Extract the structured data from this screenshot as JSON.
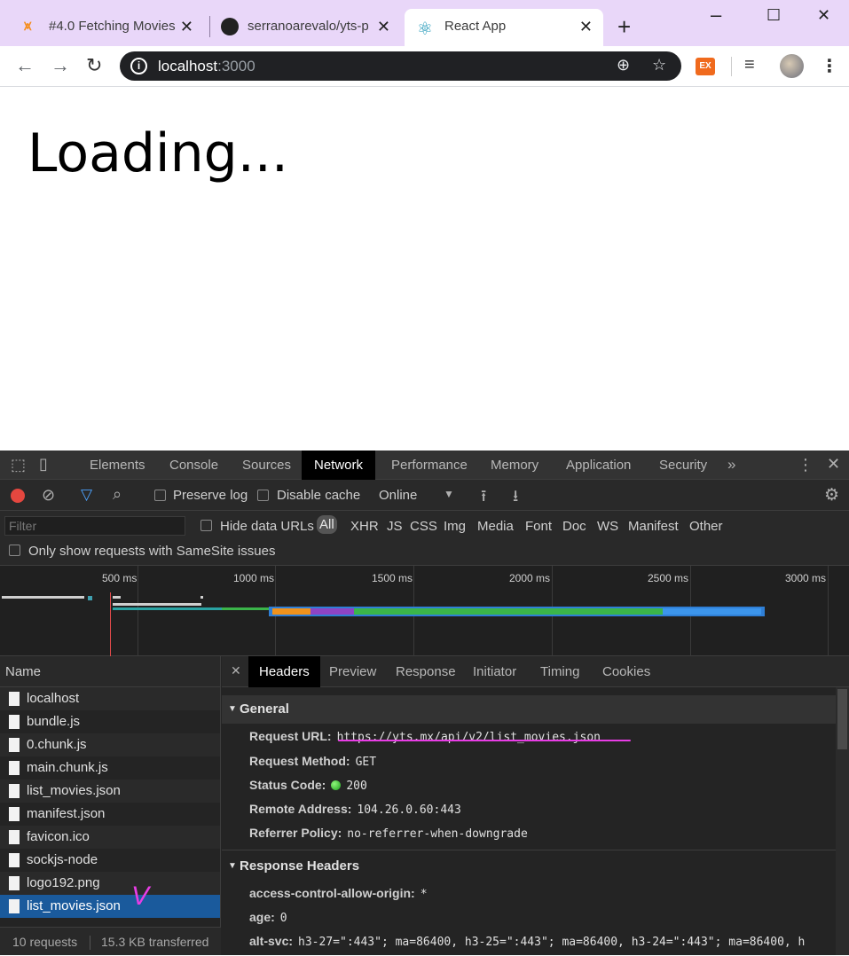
{
  "browser": {
    "tabs": [
      {
        "title": "#4.0 Fetching Movies",
        "icon": "m-logo-icon"
      },
      {
        "title": "serranoarevalo/yts-p",
        "icon": "github-icon"
      },
      {
        "title": "React App",
        "icon": "react-icon"
      }
    ],
    "url_host": "localhost",
    "url_port": ":3000",
    "ext_label": "EX"
  },
  "page": {
    "heading": "Loading..."
  },
  "devtools": {
    "panels": [
      "Elements",
      "Console",
      "Sources",
      "Network",
      "Performance",
      "Memory",
      "Application",
      "Security"
    ],
    "active_panel": "Network",
    "toolbar": {
      "preserve_log": "Preserve log",
      "disable_cache": "Disable cache",
      "throttle": "Online"
    },
    "filter": {
      "placeholder": "Filter",
      "hide_data_urls": "Hide data URLs",
      "types": [
        "All",
        "XHR",
        "JS",
        "CSS",
        "Img",
        "Media",
        "Font",
        "Doc",
        "WS",
        "Manifest",
        "Other"
      ],
      "samesite": "Only show requests with SameSite issues"
    },
    "timeline_labels": [
      "500 ms",
      "1000 ms",
      "1500 ms",
      "2000 ms",
      "2500 ms",
      "3000 ms"
    ],
    "requests_header": "Name",
    "requests": [
      "localhost",
      "bundle.js",
      "0.chunk.js",
      "main.chunk.js",
      "list_movies.json",
      "manifest.json",
      "favicon.ico",
      "sockjs-node",
      "logo192.png",
      "list_movies.json"
    ],
    "summary": {
      "requests": "10 requests",
      "transferred": "15.3 KB transferred"
    },
    "detail_tabs": [
      "Headers",
      "Preview",
      "Response",
      "Initiator",
      "Timing",
      "Cookies"
    ],
    "general": {
      "title": "General",
      "rows": [
        {
          "key": "Request URL:",
          "value": "https://yts.mx/api/v2/list_movies.json"
        },
        {
          "key": "Request Method:",
          "value": "GET"
        },
        {
          "key": "Status Code:",
          "value": "200"
        },
        {
          "key": "Remote Address:",
          "value": "104.26.0.60:443"
        },
        {
          "key": "Referrer Policy:",
          "value": "no-referrer-when-downgrade"
        }
      ]
    },
    "response_headers": {
      "title": "Response Headers",
      "rows": [
        {
          "key": "access-control-allow-origin:",
          "value": "*"
        },
        {
          "key": "age:",
          "value": "0"
        },
        {
          "key": "alt-svc:",
          "value": "h3-27=\":443\"; ma=86400, h3-25=\":443\"; ma=86400, h3-24=\":443\"; ma=86400, h"
        }
      ]
    },
    "colors": {
      "selected_row": "#1a5a9c",
      "annotation": "#e83de5"
    }
  }
}
